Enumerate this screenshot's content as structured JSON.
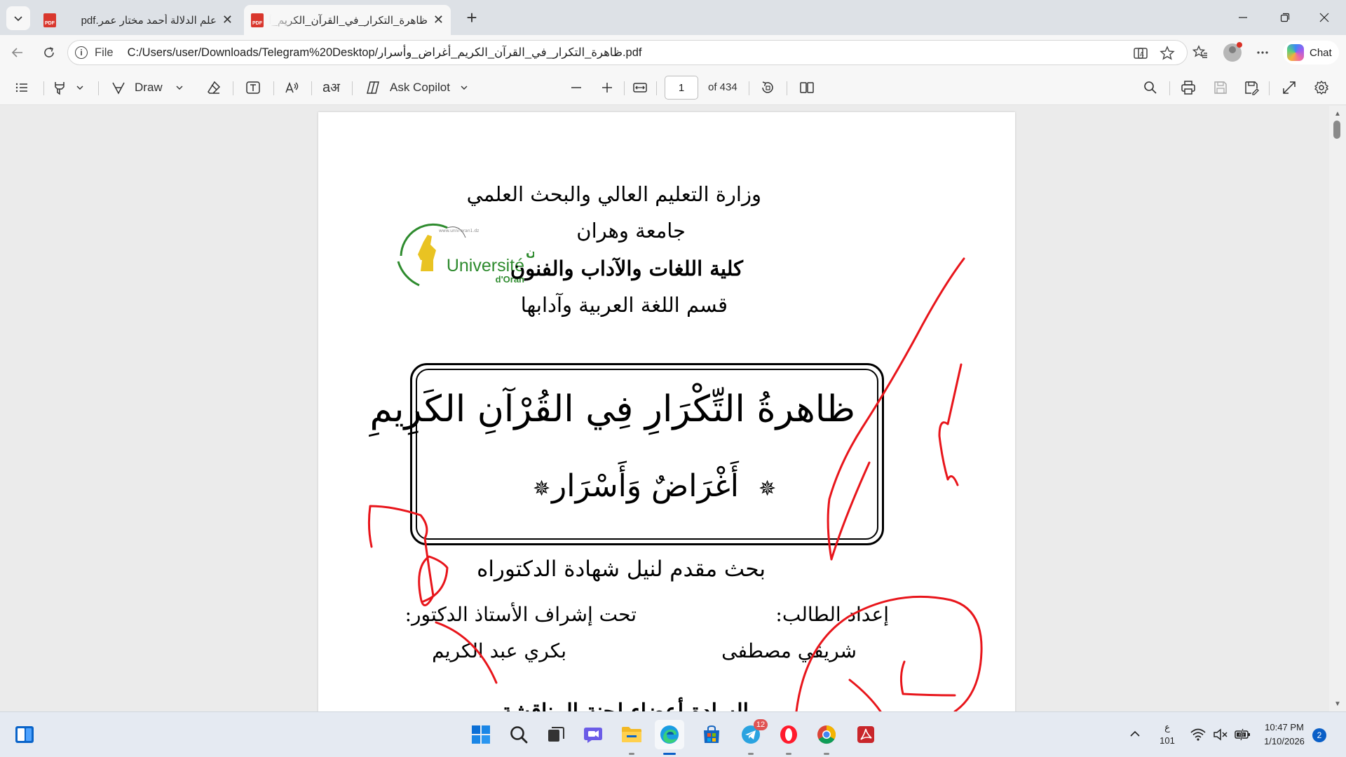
{
  "tabs": [
    {
      "title": "علم الدلالة أحمد مختار عمر.pdf",
      "active": false
    },
    {
      "title": "ظاهرة_التكرار_في_القرآن_الكريم_أغراض_وأسرار.pdf",
      "active": true
    }
  ],
  "address": {
    "scheme": "File",
    "url": "C:/Users/user/Downloads/Telegram%20Desktop/ظاهرة_التكرار_في_القرآن_الكريم_أغراض_وأسرار.pdf"
  },
  "chat": {
    "label": "Chat"
  },
  "pdf_toolbar": {
    "draw_label": "Draw",
    "ask_copilot_label": "Ask Copilot",
    "current_page": "1",
    "total_pages": "of 434"
  },
  "document": {
    "ministry": "وزارة التعليم العالي والبحث العلمي",
    "university": "جامعة وهران",
    "faculty": "كلية اللغات والآداب والفنون",
    "department": "قسم اللغة العربية وآدابها",
    "title": "ظاهرةُ التِّكْرَارِ فِي القُرْآنِ الكَرِيمِ",
    "subtitle": "أَغْرَاضٌ وَأَسْرَار",
    "degree": "بحث مقدم لنيل شهادة الدكتوراه",
    "student_label": "إعداد الطالب:",
    "student_name": "شريقي مصطفى",
    "supervisor_label": "تحت إشراف الأستاذ الدكتور:",
    "supervisor_name": "بكري عبد الكريم",
    "committee_partial": "السادة أعضاء لجنة المناقشة",
    "logo": {
      "arabic": "جامعة وهران",
      "latin": "Université",
      "latin_small": "d'Oran"
    }
  },
  "annotation_color": "#e8151b",
  "taskbar": {
    "apps": [
      "windows-start",
      "search",
      "task-view",
      "chat-meet",
      "file-explorer",
      "edge",
      "microsoft-store",
      "telegram",
      "opera",
      "chrome",
      "acrobat"
    ],
    "telegram_badge": "12",
    "language_top": "ع",
    "language_bottom": "101",
    "time": "10:47 PM",
    "date": "1/10/2026",
    "notifications": "2"
  }
}
